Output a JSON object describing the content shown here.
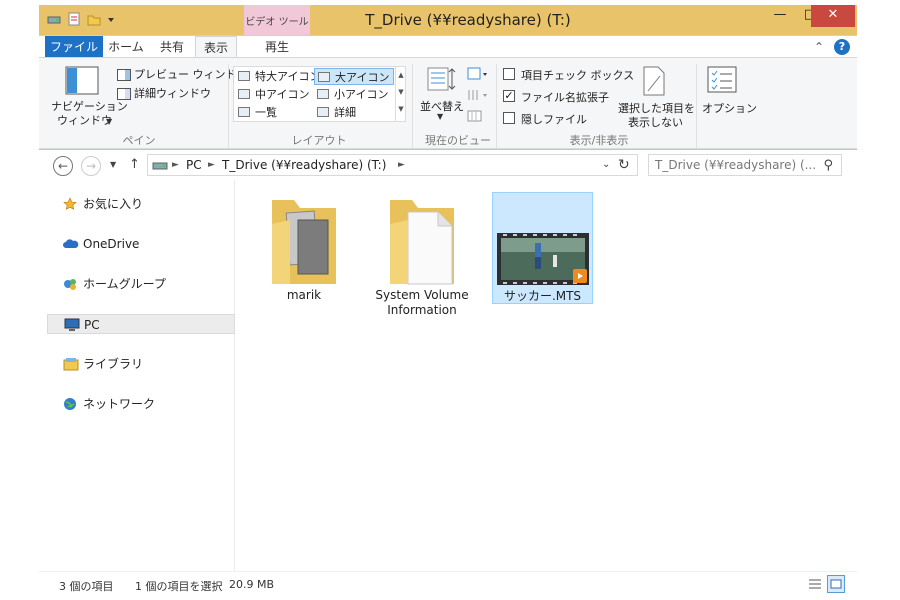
{
  "window": {
    "title": "T_Drive (¥¥readyshare) (T:)",
    "context_tab_group": "ビデオ ツール",
    "controls": {
      "minimize": "—",
      "maximize": "□",
      "close": "✕"
    }
  },
  "colors": {
    "titlebar": "#e8c36a",
    "file_tab": "#1e72c6",
    "context_tab": "#f0c8d8",
    "close": "#c9483f",
    "selection": "#cce8ff"
  },
  "tabs": [
    {
      "label": "ファイル"
    },
    {
      "label": "ホーム"
    },
    {
      "label": "共有"
    },
    {
      "label": "表示"
    },
    {
      "label": "再生"
    }
  ],
  "ribbon": {
    "pane_group": {
      "label": "ペイン",
      "nav_pane_line1": "ナビゲーション",
      "nav_pane_line2": "ウィンドウ",
      "preview_pane": "プレビュー ウィンドウ",
      "details_pane": "詳細ウィンドウ"
    },
    "layout_group": {
      "label": "レイアウト",
      "items": [
        "特大アイコン",
        "大アイコン",
        "中アイコン",
        "小アイコン",
        "一覧",
        "詳細"
      ],
      "selected": "大アイコン"
    },
    "current_view_group": {
      "label": "現在のビュー",
      "sort_by": "並べ替え"
    },
    "show_hide_group": {
      "label": "表示/非表示",
      "item_checkboxes": {
        "label": "項目チェック ボックス",
        "checked": false
      },
      "file_extensions": {
        "label": "ファイル名拡張子",
        "checked": true
      },
      "hidden_items": {
        "label": "隠しファイル",
        "checked": false
      },
      "hide_selected_line1": "選択した項目を",
      "hide_selected_line2": "表示しない"
    },
    "options": "オプション"
  },
  "address_bar": {
    "path": [
      "PC",
      "T_Drive (¥¥readyshare) (T:)"
    ],
    "search_placeholder": "T_Drive (¥¥readyshare) (... "
  },
  "nav_pane": {
    "items": [
      {
        "label": "お気に入り",
        "icon": "star-icon"
      },
      {
        "label": "OneDrive",
        "icon": "cloud-icon"
      },
      {
        "label": "ホームグループ",
        "icon": "homegroup-icon"
      },
      {
        "label": "PC",
        "icon": "pc-icon"
      },
      {
        "label": "ライブラリ",
        "icon": "library-icon"
      },
      {
        "label": "ネットワーク",
        "icon": "network-icon"
      }
    ],
    "selected": "PC"
  },
  "files": [
    {
      "name": "marik",
      "type": "folder",
      "icon": "folder-with-photos-icon"
    },
    {
      "name_line1": "System Volume",
      "name_line2": "Information",
      "type": "folder",
      "icon": "folder-icon"
    },
    {
      "name": "サッカー.MTS",
      "type": "video",
      "icon": "video-thumbnail-icon",
      "selected": true
    }
  ],
  "status_bar": {
    "item_count": "3 個の項目",
    "selection": "1 個の項目を選択",
    "size": "20.9 MB"
  }
}
